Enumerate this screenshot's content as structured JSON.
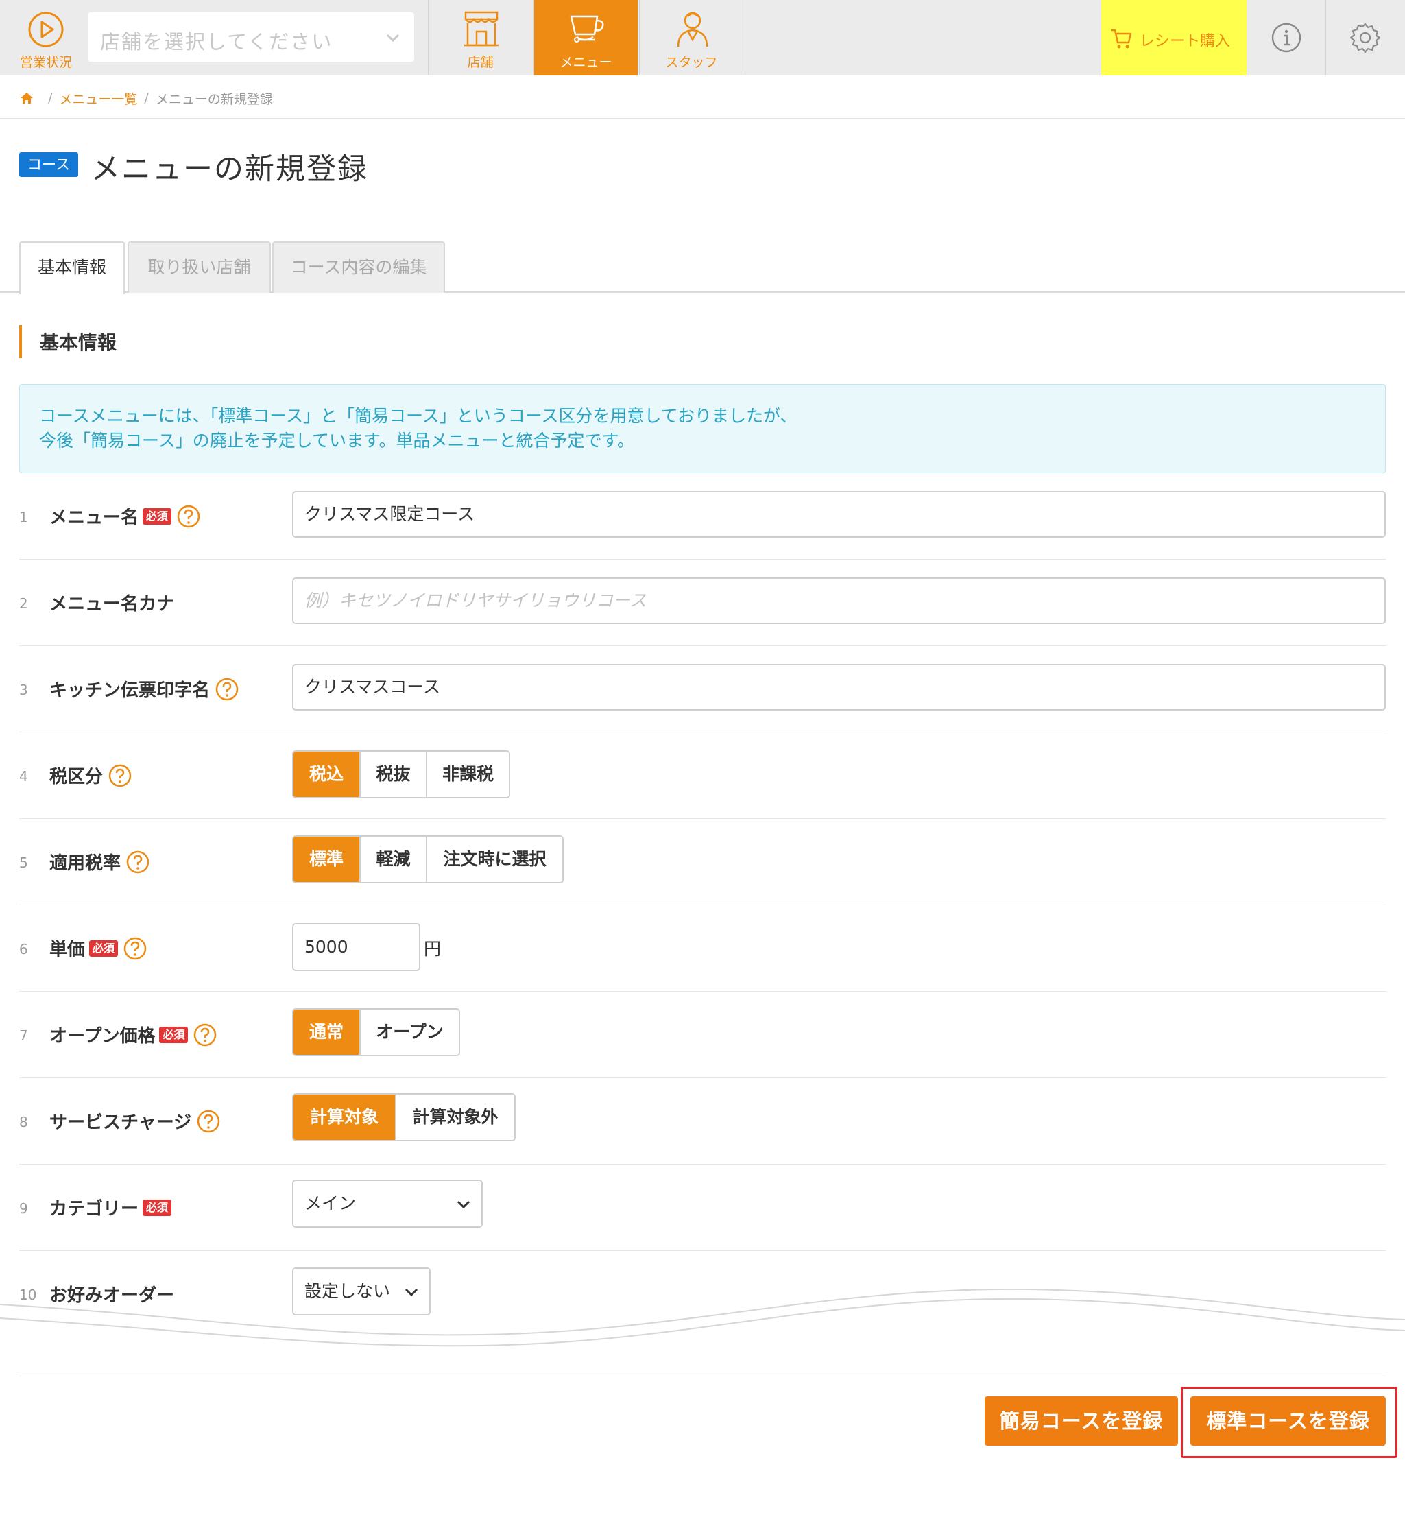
{
  "topnav": {
    "status_label": "営業状況",
    "shop_select_placeholder": "店舗を選択してください",
    "tabs": [
      {
        "label": "店舗",
        "icon": "store-icon",
        "active": false
      },
      {
        "label": "メニュー",
        "icon": "cup-icon",
        "active": true
      },
      {
        "label": "スタッフ",
        "icon": "staff-icon",
        "active": false
      }
    ],
    "receipt_label": "レシート購入",
    "info_icon": "info-icon",
    "settings_icon": "gear-icon",
    "accent_color": "#ee8b12",
    "receipt_bg": "#ffff4d"
  },
  "breadcrumb": {
    "items": [
      "メニュー一覧",
      "メニューの新規登録"
    ]
  },
  "title": {
    "badge": "コース",
    "text": "メニューの新規登録"
  },
  "tabs": [
    {
      "label": "基本情報",
      "active": true
    },
    {
      "label": "取り扱い店舗",
      "active": false
    },
    {
      "label": "コース内容の編集",
      "active": false
    }
  ],
  "section": {
    "title": "基本情報"
  },
  "notice": {
    "line1": "コースメニューには、「標準コース」と「簡易コース」というコース区分を用意しておりましたが、",
    "line2": "今後「簡易コース」の廃止を予定しています。単品メニューと統合予定です。"
  },
  "required_label": "必須",
  "form": {
    "rows": [
      {
        "num": "1",
        "label": "メニュー名",
        "value": "クリスマス限定コース"
      },
      {
        "num": "2",
        "label": "メニュー名カナ",
        "placeholder": "例）キセツノイロドリヤサイリョウリコース"
      },
      {
        "num": "3",
        "label": "キッチン伝票印字名",
        "value": "クリスマスコース"
      },
      {
        "num": "4",
        "label": "税区分",
        "options": [
          "税込",
          "税抜",
          "非課税"
        ],
        "selected": "税込"
      },
      {
        "num": "5",
        "label": "適用税率",
        "options": [
          "標準",
          "軽減",
          "注文時に選択"
        ],
        "selected": "標準"
      },
      {
        "num": "6",
        "label": "単価",
        "value": "5000",
        "unit": "円"
      },
      {
        "num": "7",
        "label": "オープン価格",
        "options": [
          "通常",
          "オープン"
        ],
        "selected": "通常"
      },
      {
        "num": "8",
        "label": "サービスチャージ",
        "options": [
          "計算対象",
          "計算対象外"
        ],
        "selected": "計算対象"
      },
      {
        "num": "9",
        "label": "カテゴリー",
        "value": "メイン"
      },
      {
        "num": "10",
        "label": "お好みオーダー",
        "value": "設定しない"
      }
    ]
  },
  "actions": {
    "simple_button": "簡易コースを登録",
    "standard_button": "標準コースを登録",
    "button_color": "#ee7e11",
    "highlight_color": "#e8262b"
  }
}
